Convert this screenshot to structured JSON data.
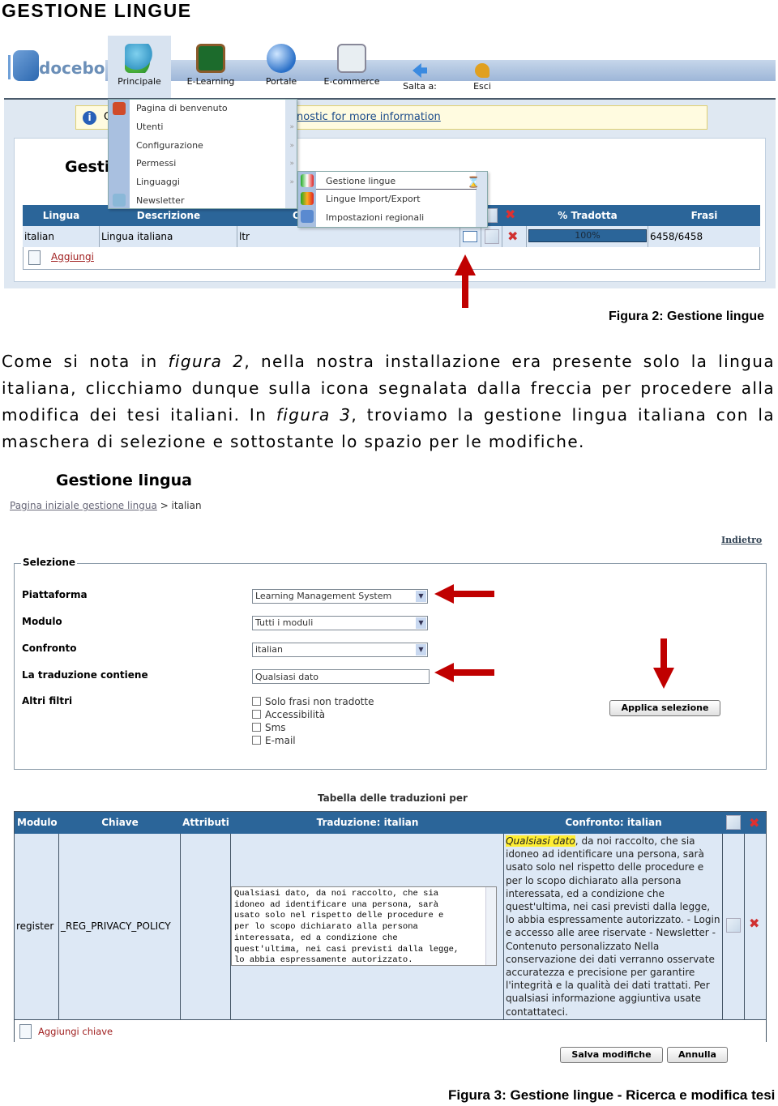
{
  "section_title": "GESTIONE LINGUE",
  "figure2": {
    "app": {
      "logo_text": "docebo",
      "nav": [
        {
          "label": "Principale",
          "icon": "users-icon",
          "active": true
        },
        {
          "label": "E-Learning",
          "icon": "chalkboard-icon"
        },
        {
          "label": "Portale",
          "icon": "globe-icon"
        },
        {
          "label": "E-commerce",
          "icon": "calculator-icon"
        },
        {
          "label": "Salta a:",
          "icon": "back-arrow-icon"
        },
        {
          "label": "Esci",
          "icon": "keys-icon"
        }
      ],
      "notice_visible_start": "C",
      "notice_link": "nostic for more information",
      "page_title_partial": "Gesti",
      "menu": {
        "items": [
          {
            "label": "Pagina di benvenuto",
            "icon": "home-icon",
            "submenu": false
          },
          {
            "label": "Utenti",
            "submenu": true
          },
          {
            "label": "Configurazione",
            "submenu": true
          },
          {
            "label": "Permessi",
            "submenu": true
          },
          {
            "label": "Linguaggi",
            "submenu": true
          },
          {
            "label": "Newsletter",
            "icon": "newsletter-icon",
            "submenu": false
          }
        ],
        "submenu": [
          {
            "label": "Gestione lingue",
            "selected": true
          },
          {
            "label": "Lingue Import/Export"
          },
          {
            "label": "Impostazioni regionali"
          }
        ]
      },
      "table": {
        "headers": [
          "Lingua",
          "Descrizione",
          "O",
          "% Tradotta",
          "Frasi"
        ],
        "row": {
          "lingua": "italian",
          "descrizione": "Lingua italiana",
          "orientamento": "ltr",
          "tradotta_percent": 100,
          "tradotta_label": "100%",
          "frasi": "6458/6458"
        },
        "add_label": "Aggiungi"
      }
    },
    "caption": "Figura 2: Gestione lingue"
  },
  "paragraph": {
    "p1": "Come si nota in ",
    "em1": "figura 2",
    "p2": ", nella nostra installazione era presente solo la lingua italiana, clicchiamo dunque sulla icona segnalata dalla freccia per procedere alla modifica dei tesi italiani. In ",
    "em2": "figura 3",
    "p3": ", troviamo la gestione lingua italiana con la maschera di selezione e sottostante lo spazio per le modifiche."
  },
  "figure3": {
    "title": "Gestione lingua",
    "breadcrumb_link": "Pagina iniziale gestione lingua",
    "breadcrumb_current": "> italian",
    "back_link": "Indietro",
    "fieldset_legend": "Selezione",
    "fields": [
      {
        "label": "Piattaforma",
        "value": "Learning Management System",
        "type": "select"
      },
      {
        "label": "Modulo",
        "value": "Tutti i moduli",
        "type": "select"
      },
      {
        "label": "Confronto",
        "value": "italian",
        "type": "select"
      },
      {
        "label": "La traduzione contiene",
        "value": "Qualsiasi dato",
        "type": "text"
      }
    ],
    "other_filters_label": "Altri filtri",
    "checkboxes": [
      {
        "label": "Solo frasi non tradotte",
        "checked": false
      },
      {
        "label": "Accessibilità",
        "checked": false
      },
      {
        "label": "Sms",
        "checked": false
      },
      {
        "label": "E-mail",
        "checked": false
      }
    ],
    "apply_button": "Applica selezione",
    "table_caption": "Tabella delle traduzioni per",
    "table_headers": [
      "Modulo",
      "Chiave",
      "Attributi",
      "Traduzione: italian",
      "Confronto: italian"
    ],
    "row": {
      "modulo": "register",
      "chiave": "_REG_PRIVACY_POLICY",
      "attributi": "",
      "traduzione": "Qualsiasi dato, da noi raccolto, che sia\nidoneo ad identificare una persona, sarà\nusato solo nel rispetto delle procedure e\nper lo scopo dichiarato alla persona\ninteressata, ed a condizione che\nquest'ultima, nei casi previsti dalla legge,\nlo abbia espressamente autorizzato.",
      "confronto_highlight": "Qualsiasi dato",
      "confronto_rest": ", da noi raccolto, che sia idoneo ad identificare una persona, sarà usato solo nel rispetto delle procedure e per lo scopo dichiarato alla persona interessata, ed a condizione che quest'ultima, nei casi previsti dalla legge, lo abbia espressamente autorizzato. - Login e accesso alle aree riservate - Newsletter - Contenuto personalizzato Nella conservazione dei dati verranno osservate accuratezza e precisione per garantire l'integrità e la qualità dei dati trattati. Per qualsiasi informazione aggiuntiva usate contattateci."
    },
    "add_key_label": "Aggiungi chiave",
    "save_button": "Salva modifiche",
    "cancel_button": "Annulla",
    "caption": "Figura 3: Gestione lingue - Ricerca e modifica tesi"
  },
  "colors": {
    "header_blue": "#2b6599",
    "arrow_red": "#c00000",
    "highlight": "#ffee33"
  }
}
